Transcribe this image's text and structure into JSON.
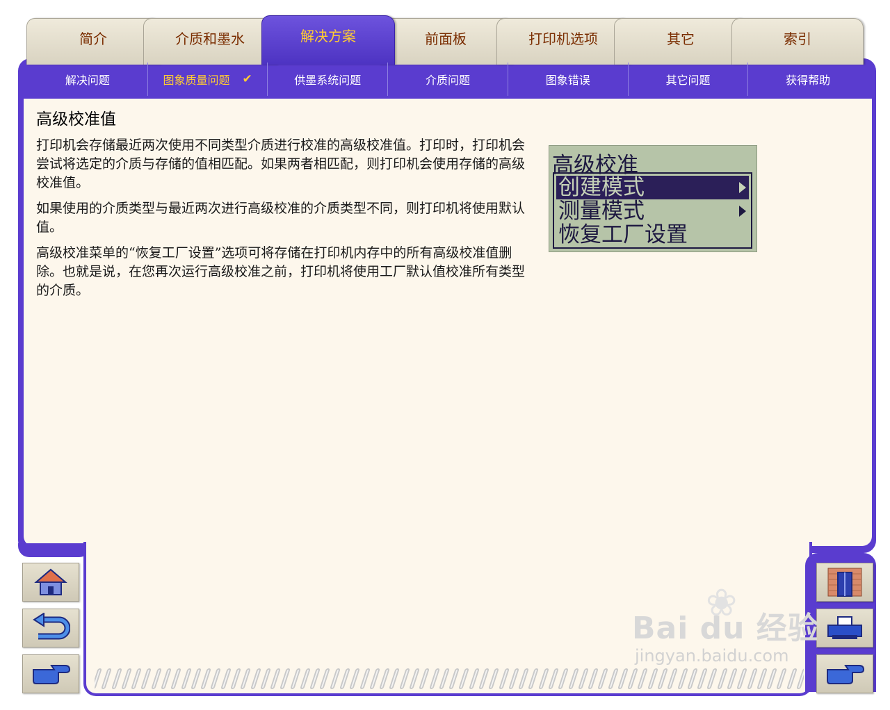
{
  "tabs": [
    {
      "label": "简介"
    },
    {
      "label": "介质和墨水"
    },
    {
      "label": "解决方案",
      "active": true
    },
    {
      "label": "前面板"
    },
    {
      "label": "打印机选项"
    },
    {
      "label": "其它"
    },
    {
      "label": "索引"
    }
  ],
  "subnav": [
    {
      "label": "解决问题"
    },
    {
      "label": "图象质量问题",
      "active": true
    },
    {
      "label": "供墨系统问题"
    },
    {
      "label": "介质问题"
    },
    {
      "label": "图象错误"
    },
    {
      "label": "其它问题"
    },
    {
      "label": "获得帮助"
    }
  ],
  "check_mark": "✔",
  "page": {
    "title": "高级校准值",
    "paragraphs": [
      "打印机会存储最近两次使用不同类型介质进行校准的高级校准值。打印时，打印机会尝试将选定的介质与存储的值相匹配。如果两者相匹配，则打印机会使用存储的高级校准值。",
      "如果使用的介质类型与最近两次进行高级校准的介质类型不同，则打印机将使用默认值。",
      "高级校准菜单的“恢复工厂设置”选项可将存储在打印机内存中的所有高级校准值删除。也就是说，在您再次运行高级校准之前，打印机将使用工厂默认值校准所有类型的介质。"
    ]
  },
  "lcd": {
    "title": "高级校准",
    "items": [
      {
        "label": "创建模式",
        "selected": true,
        "has_submenu": true
      },
      {
        "label": "测量模式",
        "selected": false,
        "has_submenu": true
      },
      {
        "label": "恢复工厂设置",
        "selected": false,
        "has_submenu": false
      }
    ]
  },
  "nav_buttons": {
    "left": [
      "home-icon",
      "back-icon",
      "forward-hand-icon"
    ],
    "right": [
      "exit-door-icon",
      "printer-icon",
      "next-hand-icon"
    ]
  },
  "watermark": {
    "brand": "Bai du 经验",
    "url": "jingyan.baidu.com"
  },
  "colors": {
    "frame": "#5a3ccf",
    "tab_active_text": "#ffcc33",
    "tab_text": "#7a2d00",
    "content_bg": "#fdf7ec",
    "lcd_bg": "#b6c4a8"
  }
}
